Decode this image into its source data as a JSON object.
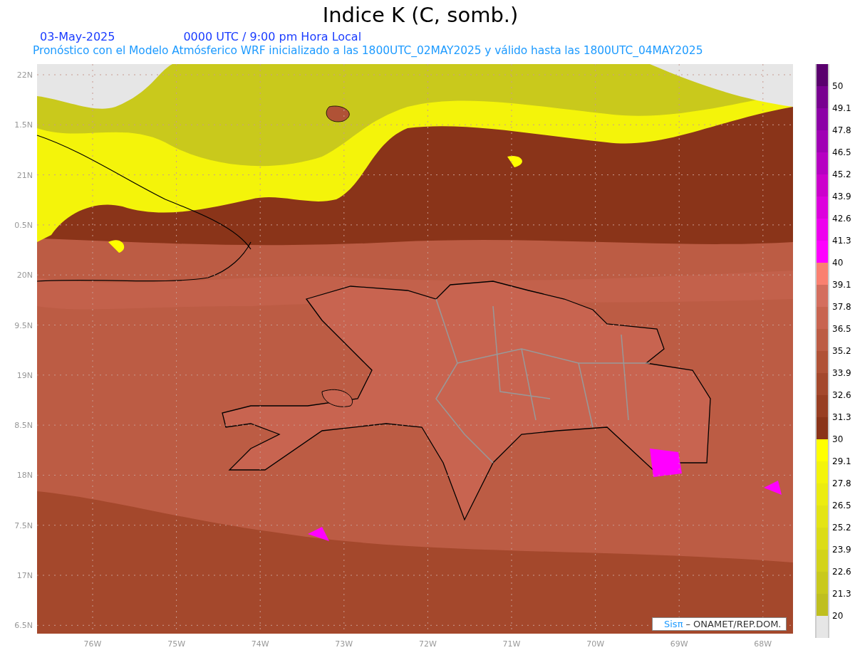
{
  "title": "Indice K (C, somb.)",
  "date": "03-May-2025",
  "time": "0000 UTC / 9:00 pm Hora Local",
  "subtitle": "Pronóstico con el Modelo Atmósferico WRF inicializado a las 1800UTC_02MAY2025 y válido hasta las  1800UTC_04MAY2025",
  "y_labels": [
    "22N",
    "1.5N",
    "21N",
    "0.5N",
    "20N",
    "9.5N",
    "19N",
    "8.5N",
    "18N",
    "7.5N",
    "17N",
    "6.5N"
  ],
  "x_labels": [
    "76W",
    "75W",
    "74W",
    "73W",
    "72W",
    "71W",
    "70W",
    "69W",
    "68W"
  ],
  "colorbar": {
    "segments": [
      {
        "color": "#5a006e"
      },
      {
        "color": "#780090"
      },
      {
        "color": "#8c00a6"
      },
      {
        "color": "#a000b4"
      },
      {
        "color": "#b600c2"
      },
      {
        "color": "#cc00cc"
      },
      {
        "color": "#dd00dd"
      },
      {
        "color": "#ee00ee"
      },
      {
        "color": "#ff00ff"
      },
      {
        "color": "#fa8070"
      },
      {
        "color": "#d46e5e"
      },
      {
        "color": "#c86450"
      },
      {
        "color": "#bc5c44"
      },
      {
        "color": "#b05236"
      },
      {
        "color": "#a4482c"
      },
      {
        "color": "#983e22"
      },
      {
        "color": "#8a3419"
      },
      {
        "color": "#ffff00"
      },
      {
        "color": "#f4f40a"
      },
      {
        "color": "#ecec10"
      },
      {
        "color": "#e4e414"
      },
      {
        "color": "#dcdc17"
      },
      {
        "color": "#d3d31a"
      },
      {
        "color": "#c9c91c"
      },
      {
        "color": "#bfbf1f"
      },
      {
        "color": "#e6e6e6"
      }
    ],
    "labels": [
      "50",
      "49.1",
      "47.8",
      "46.5",
      "45.2",
      "43.9",
      "42.6",
      "41.3",
      "40",
      "39.1",
      "37.8",
      "36.5",
      "35.2",
      "33.9",
      "32.6",
      "31.3",
      "30",
      "29.1",
      "27.8",
      "26.5",
      "25.2",
      "23.9",
      "22.6",
      "21.3",
      "20"
    ]
  },
  "credit": {
    "logo": "Sisπ",
    "text": "– ONAMET/REP.DOM."
  }
}
